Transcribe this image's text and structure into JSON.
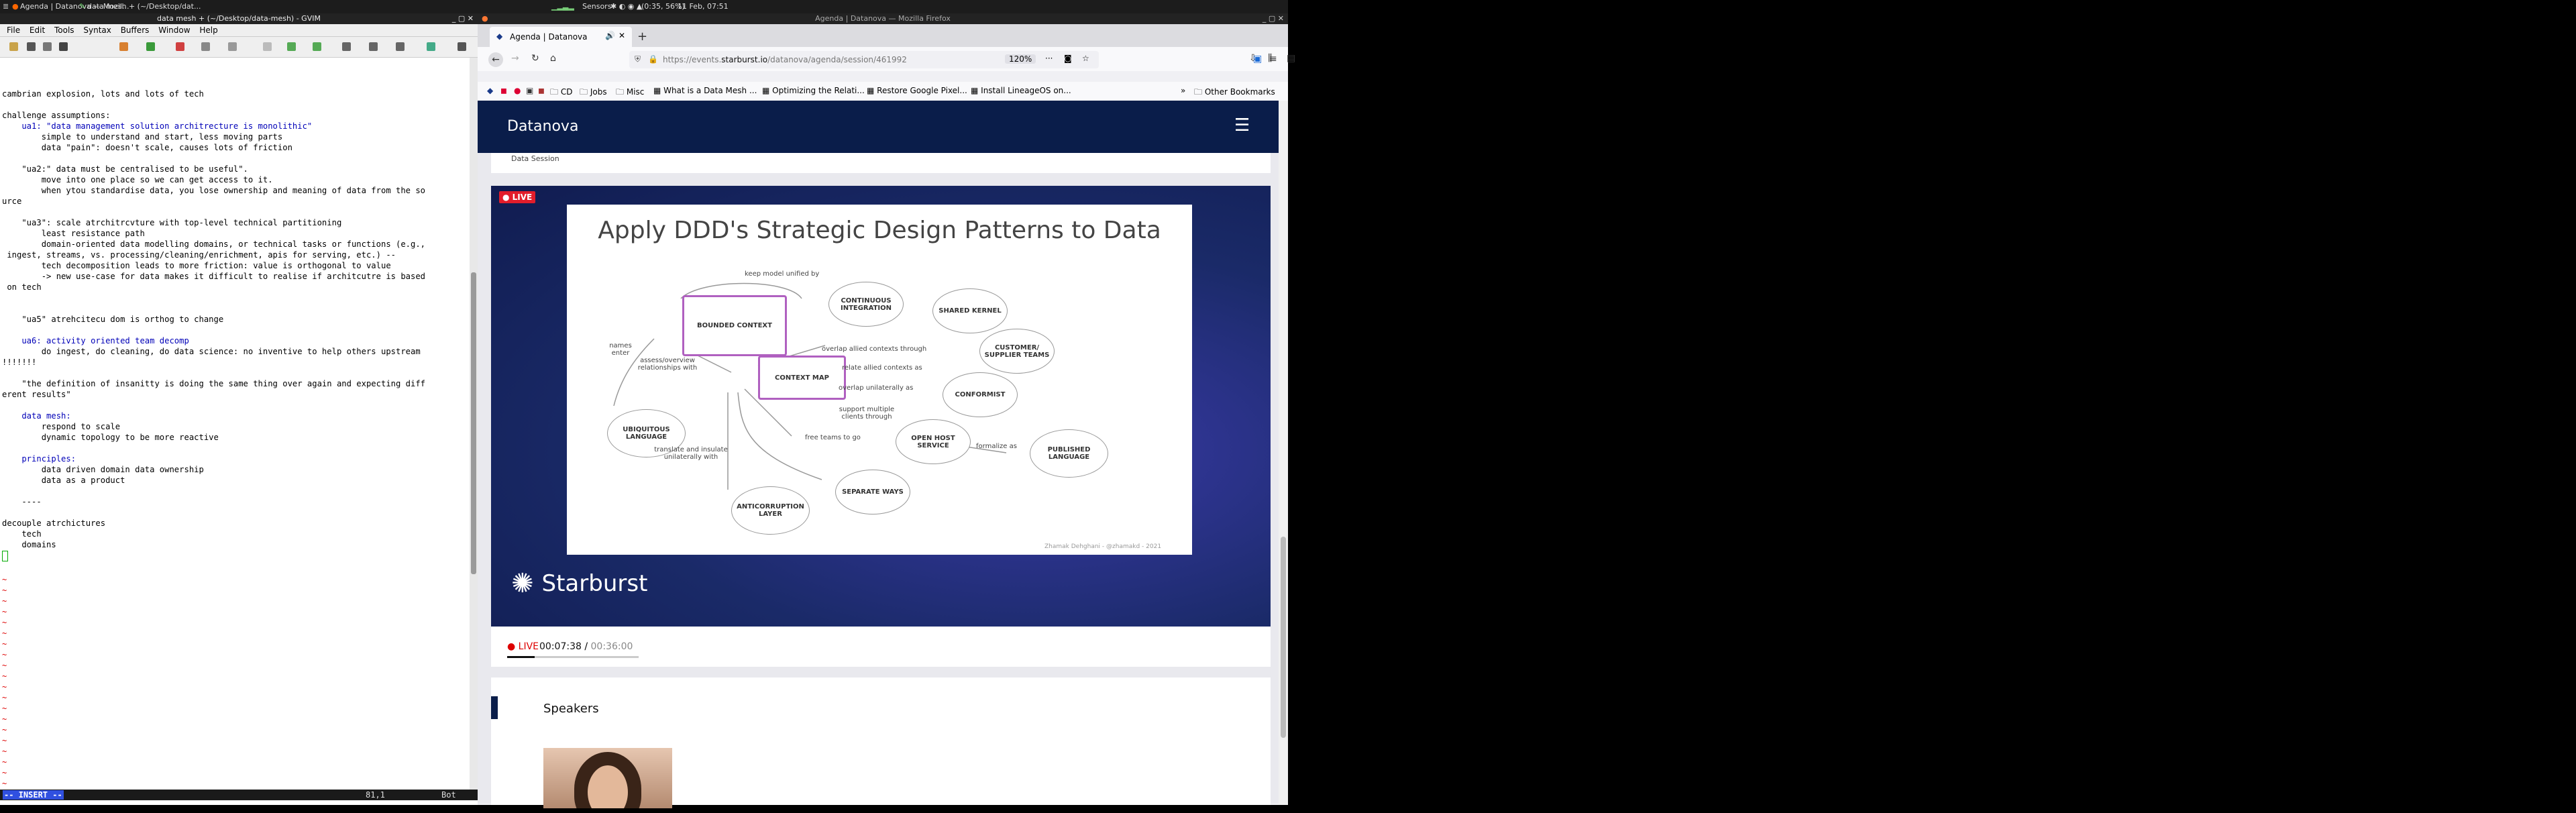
{
  "taskbar": {
    "items": [
      "Agenda | Datanova — Mozil...",
      "data mesh + (~/Desktop/dat..."
    ],
    "sensors": "Sensors",
    "battery": "(0:35, 56%)",
    "clock": "11 Feb, 07:51"
  },
  "gvim": {
    "title": "data mesh + (~/Desktop/data-mesh) - GVIM",
    "menu": [
      "File",
      "Edit",
      "Tools",
      "Syntax",
      "Buffers",
      "Window",
      "Help"
    ],
    "lines": [
      "cambrian explosion, lots and lots of tech",
      "",
      "challenge assumptions:",
      "    ua1: \"data management solution architrecture is monolithic\"",
      "        simple to understand and start, less moving parts",
      "        data \"pain\": doesn't scale, causes lots of friction",
      "",
      "    \"ua2:\" data must be centralised to be useful\".",
      "        move into one place so we can get access to it.",
      "        when ytou standardise data, you lose ownership and meaning of data from the so",
      "urce",
      "",
      "    \"ua3\": scale atrchitrcvture with top-level technical partitioning",
      "        least resistance path",
      "        domain-oriented data modelling domains, or technical tasks or functions (e.g.,",
      " ingest, streams, vs. processing/cleaning/enrichment, apis for serving, etc.) --",
      "        tech decomposition leads to more friction: value is orthogonal to value",
      "        -> new use-case for data makes it difficult to realise if architcutre is based",
      " on tech",
      "",
      "",
      "    \"ua5\" atrehcitecu dom is orthog to change",
      "",
      "    ua6: activity oriented team decomp",
      "        do ingest, do cleaning, do data science: no inventive to help others upstream",
      "!!!!!!!",
      "",
      "    \"the definition of insanitty is doing the same thing over again and expecting diff",
      "erent results\"",
      "",
      "    data mesh:",
      "        respond to scale",
      "        dynamic topology to be more reactive",
      "",
      "    principles:",
      "        data driven domain data ownership",
      "        data as a product",
      "",
      "    ----",
      "",
      "decouple atrchictures",
      "    tech",
      "    domains",
      "",
      ""
    ],
    "mode": "-- INSERT --",
    "position": "81,1",
    "scroll": "Bot"
  },
  "firefox": {
    "window_title": "Agenda | Datanova — Mozilla Firefox",
    "tab_title": "Agenda | Datanova",
    "url_prefix": "https://events.",
    "url_domain": "starburst.io",
    "url_suffix": "/datanova/agenda/session/461992",
    "zoom": "120%",
    "bookmarks": [
      "CD",
      "Jobs",
      "Misc",
      "What is a Data Mesh ...",
      "Optimizing the Relati...",
      "Restore Google Pixel...",
      "Install LineageOS on..."
    ],
    "other_bookmarks": "Other Bookmarks"
  },
  "site": {
    "brand": "Datanova",
    "live_badge": "LIVE",
    "slide_title": "Apply DDD's Strategic Design Patterns to Data",
    "slide_credit": "Zhamak Dehghani - @zhamakd - 2021",
    "nodes": {
      "bounded_context": "BOUNDED CONTEXT",
      "continuous_integration": "CONTINUOUS INTEGRATION",
      "shared_kernel": "SHARED KERNEL",
      "customer_supplier": "CUSTOMER/ SUPPLIER TEAMS",
      "conformist": "CONFORMIST",
      "context_map": "CONTEXT MAP",
      "ubiquitous_language": "UBIQUITOUS LANGUAGE",
      "open_host_service": "OPEN HOST SERVICE",
      "published_language": "PUBLISHED LANGUAGE",
      "separate_ways": "SEPARATE WAYS",
      "anticorruption_layer": "ANTICORRUPTION LAYER"
    },
    "edges": {
      "keep_unified": "keep model unified by",
      "names_enter": "names enter",
      "assess": "assess/overview relationships with",
      "overlap_contexts": "overlap allied contexts through",
      "relate_allied": "relate allied contexts as",
      "overlap_unilaterally": "overlap unilaterally as",
      "support_multiple": "support multiple clients through",
      "free_teams": "free teams to go",
      "translate": "translate and insulate unilaterally with",
      "formalize": "formalize as"
    },
    "sponsor": "Starburst",
    "controls": {
      "live": "LIVE",
      "current_time": "00:07:38",
      "separator": " / ",
      "total_time": "00:36:00",
      "progress": 0.21
    },
    "speakers_title": "Speakers",
    "partial_text": "Data Session"
  }
}
